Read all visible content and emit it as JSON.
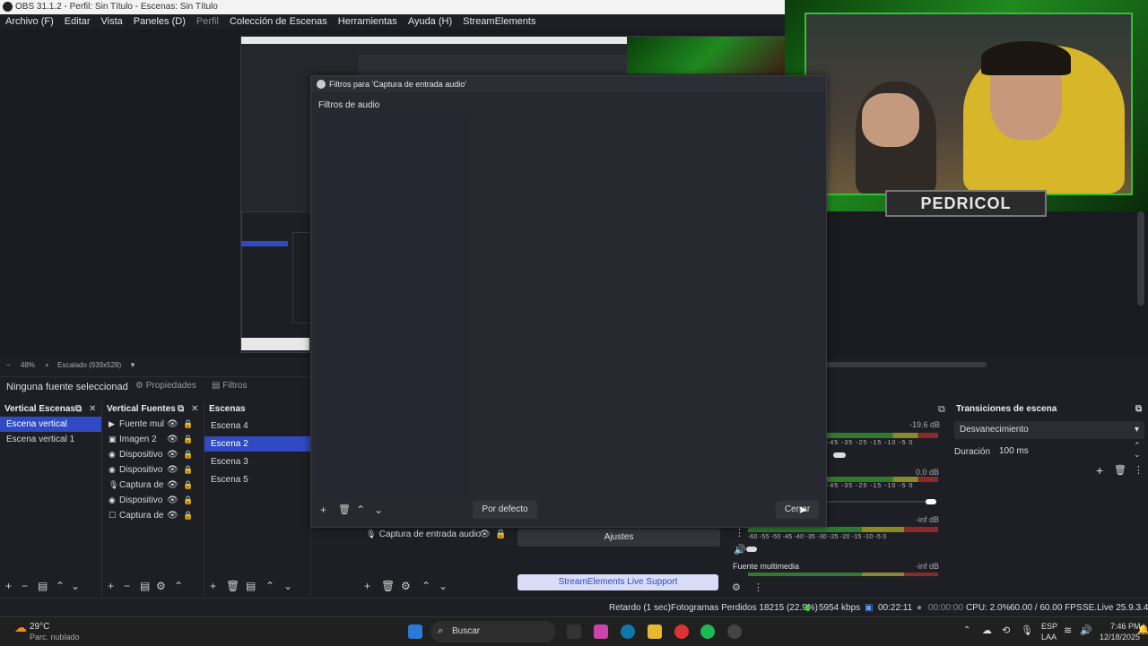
{
  "window": {
    "title": "OBS 31.1.2 - Perfil: Sin Título - Escenas: Sin Título"
  },
  "menu": [
    "Archivo (F)",
    "Editar",
    "Vista",
    "Paneles (D)",
    "Perfil",
    "Colección de Escenas",
    "Herramientas",
    "Ayuda (H)",
    "StreamElements"
  ],
  "preview": {
    "zoom": "48%",
    "scale_label": "Escalado (939x528)",
    "webcam_name": "PEDRICOL"
  },
  "source_toolbar": {
    "no_source": "Ninguna fuente seleccionad",
    "properties": "Propiedades",
    "filters": "Filtros"
  },
  "vertical_scenes": {
    "title": "Vertical Escenas",
    "items": [
      "Escena vertical",
      "Escena vertical 1"
    ],
    "selected": 0
  },
  "vertical_sources": {
    "title": "Vertical Fuentes",
    "items": [
      {
        "icon": "play-icon",
        "glyph": "▶",
        "label": "Fuente mul"
      },
      {
        "icon": "image-icon",
        "glyph": "▣",
        "label": "Imagen 2"
      },
      {
        "icon": "camera-icon",
        "glyph": "◉",
        "label": "Dispositivo"
      },
      {
        "icon": "camera-icon",
        "glyph": "◉",
        "label": "Dispositivo"
      },
      {
        "icon": "mic-icon",
        "glyph": "🎙",
        "label": "Captura de"
      },
      {
        "icon": "camera-icon",
        "glyph": "◉",
        "label": "Dispositivo"
      },
      {
        "icon": "window-icon",
        "glyph": "☐",
        "label": "Captura de"
      }
    ]
  },
  "scenes": {
    "title": "Escenas",
    "items": [
      "Escena 4",
      "Escena 2",
      "Escena 3",
      "Escena 5"
    ],
    "selected": 1
  },
  "filters_dialog": {
    "title": "Filtros para 'Captura de entrada audio'",
    "section": "Filtros de audio",
    "default_button": "Por defecto",
    "close_button": "Cerrar"
  },
  "sources_bottom": {
    "audio_source": "Captura de entrada audio"
  },
  "controls": {
    "settings": "Ajustes",
    "support": "StreamElements Live Support"
  },
  "mixer": {
    "ticks": "-45 -35 -25 -15 -10 -5 0",
    "ticks_wide": "-60 -55 -50 -45 -40 -35 -30 -25 -20 -15 -10 -5 0",
    "levels": [
      "-19.6 dB",
      "0.0 dB",
      "-inf dB",
      "-inf dB"
    ],
    "media_label": "Fuente multimedia"
  },
  "transitions": {
    "title": "Transiciones de escena",
    "selected": "Desvanecimiento",
    "duration_label": "Duración",
    "duration_value": "100 ms"
  },
  "status": {
    "delay": "Retardo (1 sec)",
    "dropped": "Fotogramas Perdidos 18215 (22.9%)",
    "bitrate": "5954 kbps",
    "live_time": "00:22:11",
    "rec_time": "00:00:00",
    "cpu": "CPU: 2.0%",
    "fps": "60.00 / 60.00 FPS",
    "se_version": "SE.Live 25.9.3.493"
  },
  "taskbar": {
    "temp": "29°C",
    "weather": "Parc. nublado",
    "search": "Buscar",
    "lang": "ESP",
    "region": "LAA",
    "time": "7:46 PM",
    "date": "12/18/2025"
  },
  "colors": {
    "accent": "#2f4ac2",
    "frame_green": "#35c035"
  }
}
